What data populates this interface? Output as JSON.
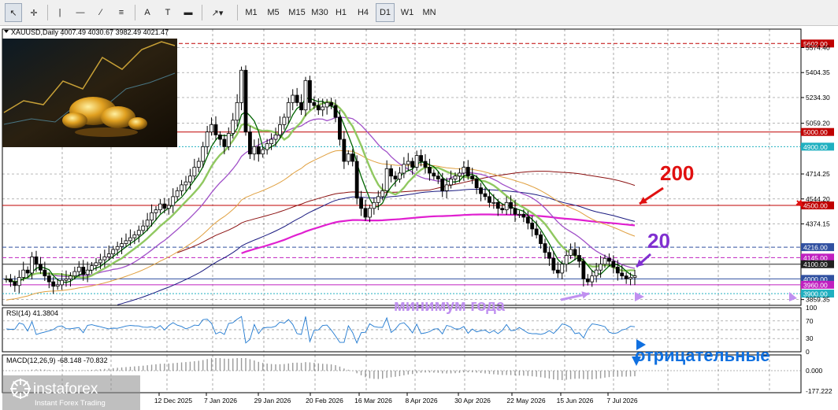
{
  "toolbar": {
    "tools": [
      {
        "name": "cursor-icon",
        "glyph": "↖",
        "active": true
      },
      {
        "name": "crosshair-icon",
        "glyph": "✛",
        "active": false
      },
      {
        "name": "vertical-line-icon",
        "glyph": "|",
        "active": false
      },
      {
        "name": "horizontal-line-icon",
        "glyph": "—",
        "active": false
      },
      {
        "name": "trendline-icon",
        "glyph": "∕",
        "active": false
      },
      {
        "name": "fibonacci-icon",
        "glyph": "≡",
        "active": false
      },
      {
        "name": "text-icon",
        "glyph": "A",
        "active": false
      },
      {
        "name": "label-icon",
        "glyph": "T",
        "active": false
      },
      {
        "name": "rectangle-icon",
        "glyph": "▬",
        "active": false
      },
      {
        "name": "shapes-menu-icon",
        "glyph": "↗▾",
        "active": false
      }
    ],
    "timeframes": [
      "M1",
      "M5",
      "M15",
      "M30",
      "H1",
      "H4",
      "D1",
      "W1",
      "MN"
    ],
    "active_timeframe": "D1"
  },
  "chart_header": "XAUUSD,Daily  4007.49 4030.67 3982.49 4021.47",
  "rsi_header": "RSI(14) 41.3804",
  "macd_header": "MACD(12,26,9) -68.148 -70.832",
  "annotations": {
    "ma200": "200",
    "ma20": "20",
    "year_low": "минимум года",
    "negative": "отрицательные"
  },
  "watermark": {
    "brand": "instaforex",
    "tagline": "Instant Forex Trading"
  },
  "colors": {
    "candle": "#000000",
    "ma_green_dark": "#006400",
    "ma_green_light": "#90c860",
    "ma_violet": "#a050c8",
    "ma_orange": "#e0a040",
    "ma_navy": "#1a1a80",
    "ma_magenta": "#e020d0",
    "ma_darkred": "#8b1010",
    "level_red": "#c00000",
    "level_cyan": "#20b0c0",
    "level_blue": "#3050a0",
    "rsi_line": "#1e78d0",
    "annotation_red": "#e01010",
    "annotation_violet": "#8030d0",
    "annotation_lavender": "#c090f0",
    "annotation_blue": "#1070e0"
  },
  "chart_data": {
    "type": "candlestick",
    "symbol": "XAUUSD",
    "timeframe": "Daily",
    "ohlc_last": {
      "open": 4007.49,
      "high": 4030.67,
      "low": 3982.49,
      "close": 4021.47
    },
    "price_axis_ticks": [
      5574.4,
      5404.35,
      5234.3,
      5059.2,
      4714.25,
      4544.2,
      4374.15,
      3859.35
    ],
    "ylim": [
      3820,
      5700
    ],
    "date_axis_labels": [
      "12 Dec 2025",
      "7 Jan 2026",
      "29 Jan 2026",
      "20 Feb 2026",
      "16 Mar 2026",
      "8 Apr 2026",
      "30 Apr 2026",
      "22 May 2026",
      "15 Jun 2026",
      "7 Jul 2026"
    ],
    "price_levels": [
      {
        "value": 5602.0,
        "label": "5602.00",
        "color": "#c00000",
        "style": "dashed"
      },
      {
        "value": 5000.0,
        "label": "5000.00",
        "color": "#c00000",
        "style": "solid"
      },
      {
        "value": 4900.0,
        "label": "4900.00",
        "color": "#20b0c0",
        "style": "dotted"
      },
      {
        "value": 4500.0,
        "label": "4500.00",
        "color": "#c00000",
        "style": "solid"
      },
      {
        "value": 4216.0,
        "label": "4216.00",
        "color": "#3050a0",
        "style": "dashed"
      },
      {
        "value": 4145.0,
        "label": "4145.00",
        "color": "#c020c0",
        "style": "dashed"
      },
      {
        "value": 4100.0,
        "label": "4100.00",
        "color": "#202020",
        "style": "solid"
      },
      {
        "value": 4000.0,
        "label": "4000.00",
        "color": "#3050a0",
        "style": "solid"
      },
      {
        "value": 3960.0,
        "label": "3960.00",
        "color": "#c020c0",
        "style": "solid"
      },
      {
        "value": 3900.0,
        "label": "3900.00",
        "color": "#20b0c0",
        "style": "dotted"
      }
    ],
    "close_series": [
      4000,
      3980,
      3955,
      4010,
      4060,
      4040,
      4150,
      4100,
      4060,
      4020,
      3980,
      3950,
      3960,
      3990,
      4000,
      4020,
      4050,
      4080,
      4030,
      4060,
      4090,
      4110,
      4130,
      4150,
      4170,
      4200,
      4220,
      4240,
      4260,
      4280,
      4300,
      4330,
      4360,
      4400,
      4450,
      4470,
      4510,
      4480,
      4500,
      4560,
      4600,
      4640,
      4660,
      4700,
      4760,
      4800,
      4900,
      5000,
      5050,
      4980,
      4950,
      4900,
      4990,
      5080,
      5200,
      5420,
      5000,
      4850,
      4900,
      4850,
      4880,
      4920,
      4950,
      4980,
      5050,
      5100,
      5200,
      5250,
      5200,
      5150,
      5350,
      5200,
      5180,
      5150,
      5170,
      5200,
      5180,
      5100,
      4950,
      4800,
      4850,
      4800,
      4550,
      4480,
      4420,
      4480,
      4520,
      4560,
      4600,
      4750,
      4700,
      4680,
      4720,
      4780,
      4800,
      4760,
      4840,
      4800,
      4760,
      4720,
      4700,
      4680,
      4600,
      4640,
      4680,
      4700,
      4720,
      4760,
      4700,
      4680,
      4620,
      4580,
      4560,
      4520,
      4520,
      4480,
      4470,
      4520,
      4480,
      4440,
      4440,
      4420,
      4380,
      4340,
      4300,
      4240,
      4180,
      4140,
      4060,
      4040,
      4100,
      4160,
      4200,
      4160,
      4120,
      4000,
      3980,
      4020,
      4060,
      4100,
      4140,
      4120,
      4080,
      4040,
      4020,
      4000,
      4010,
      4021
    ],
    "moving_averages": [
      "SMA 5",
      "SMA 10",
      "SMA 20",
      "SMA 50",
      "SMA 100",
      "SMA 200",
      "EMA 50",
      "EMA 100"
    ],
    "rsi": {
      "period": 14,
      "value": 41.3804,
      "levels": [
        70,
        50,
        30
      ],
      "axis_ticks": [
        100,
        70,
        30,
        0
      ],
      "ylim": [
        0,
        100
      ]
    },
    "macd": {
      "fast": 12,
      "slow": 26,
      "signal": 9,
      "value": -68.148,
      "signal_value": -70.832,
      "axis_ticks": [
        0.0,
        -177.222
      ]
    }
  }
}
